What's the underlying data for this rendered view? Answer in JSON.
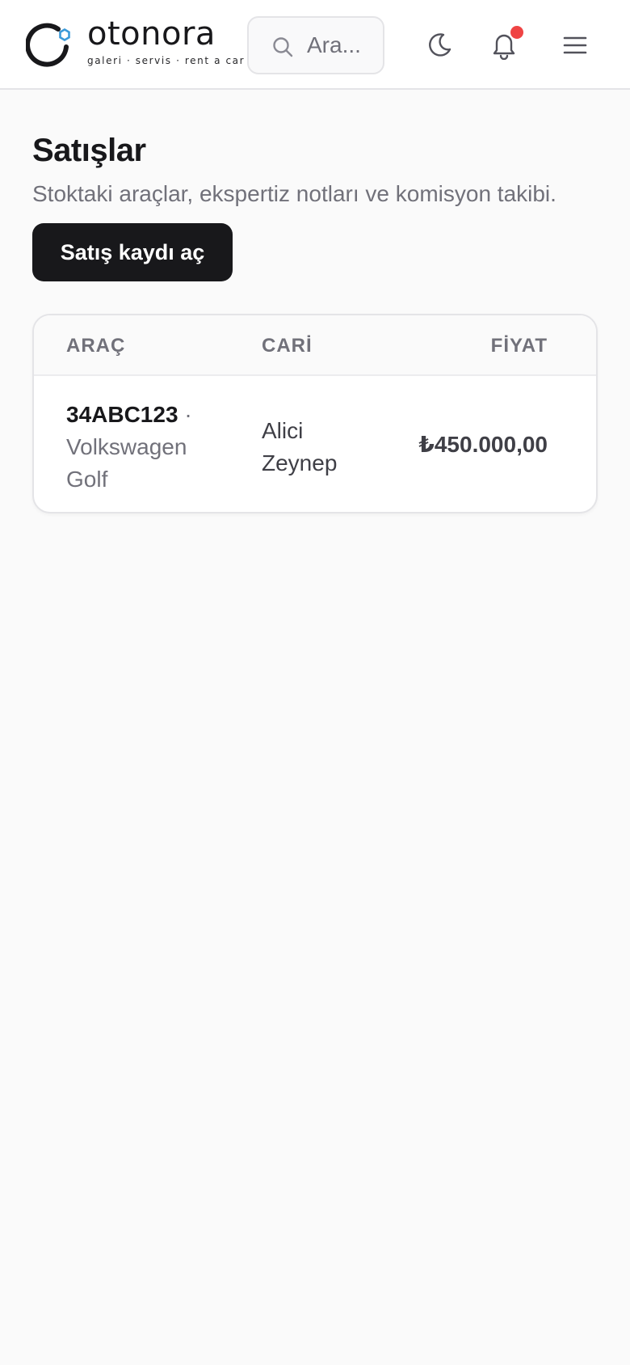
{
  "brand": {
    "name": "otonora",
    "tagline": "galeri · servis · rent a car",
    "accent_color": "#3b9ad9",
    "mark_icon": "logo-ring-icon"
  },
  "header": {
    "search": {
      "placeholder": "Ara...",
      "value": "",
      "icon": "search-icon"
    },
    "theme_icon": "moon-icon",
    "notifications": {
      "icon": "bell-icon",
      "has_unread": true,
      "dot_color": "#ef4444"
    },
    "menu_icon": "hamburger-menu-icon"
  },
  "page": {
    "title": "Satışlar",
    "subtitle": "Stoktaki araçlar, ekspertiz notları ve komisyon takibi.",
    "primary_action": "Satış kaydı aç"
  },
  "table": {
    "columns": [
      "ARAÇ",
      "CARİ",
      "FİYAT"
    ],
    "rows": [
      {
        "plate": "34ABC123",
        "separator": "·",
        "model": "Volkswagen Golf",
        "party": "Alici Zeynep",
        "price": "₺450.000,00"
      }
    ]
  }
}
